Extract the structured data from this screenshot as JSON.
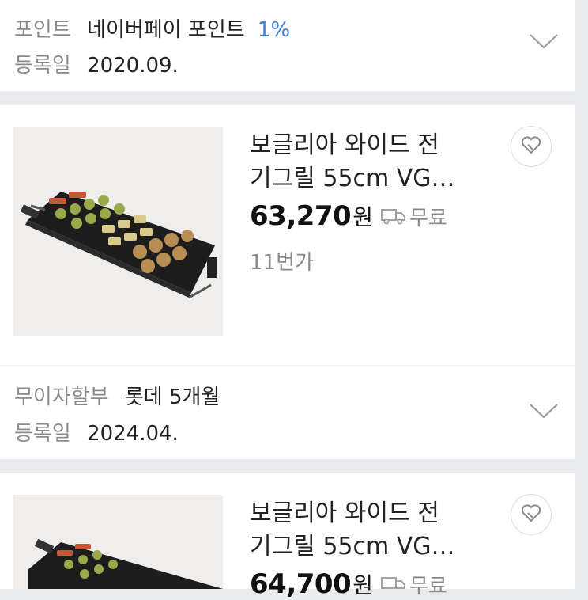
{
  "top_info": {
    "point_label": "포인트",
    "point_value": "네이버페이 포인트",
    "point_rate": "1%",
    "reg_label": "등록일",
    "reg_value": "2020.09."
  },
  "products": [
    {
      "title_line1": "보글리아 와이드 전",
      "title_line2": "기그릴 55cm VG…",
      "price": "63,270",
      "price_unit": "원",
      "shipping": "무료",
      "seller": "11번가",
      "info": {
        "label": "무이자할부",
        "value": "롯데 5개월",
        "reg_label": "등록일",
        "reg_value": "2024.04."
      }
    },
    {
      "title_line1": "보글리아 와이드 전",
      "title_line2": "기그릴 55cm VG…",
      "price": "64,700",
      "price_unit": "원",
      "shipping": "무료"
    }
  ],
  "icons": {
    "chevron": "chevron-down-icon",
    "wish": "heart-tag-icon",
    "shipping": "delivery-truck-icon"
  }
}
